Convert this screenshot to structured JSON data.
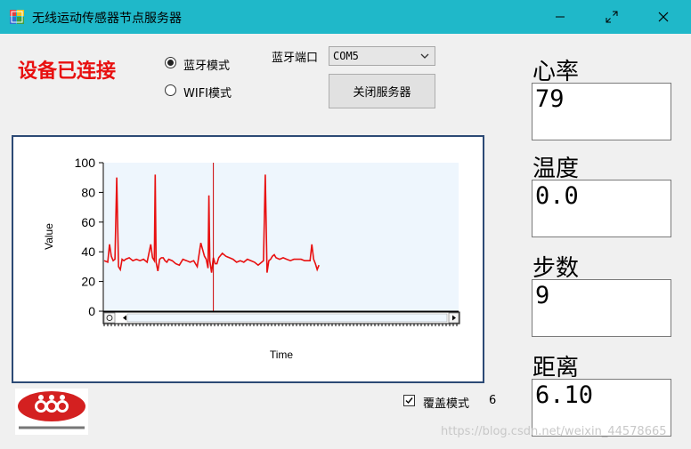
{
  "window": {
    "title": "无线运动传感器节点服务器",
    "buttons": [
      "minimize-icon",
      "maximize-icon",
      "close-icon"
    ]
  },
  "status": {
    "text": "设备已连接",
    "color": "#e81010"
  },
  "modes": [
    {
      "label": "蓝牙模式",
      "selected": true
    },
    {
      "label": "WIFI模式",
      "selected": false
    }
  ],
  "port": {
    "label": "蓝牙端口",
    "selected": "COM5"
  },
  "server_button": {
    "label": "关闭服务器"
  },
  "readings": [
    {
      "label": "心率",
      "value": "79"
    },
    {
      "label": "温度",
      "value": "0.0"
    },
    {
      "label": "步数",
      "value": "9"
    },
    {
      "label": "距离",
      "value": "6.10"
    }
  ],
  "overlay": {
    "label": "覆盖模式",
    "checked": true,
    "count": "6"
  },
  "watermark": "https://blog.csdn.net/weixin_44578665",
  "chart_data": {
    "type": "line",
    "xlabel": "Time",
    "ylabel": "Value",
    "ylim": [
      0,
      100
    ],
    "yticks": [
      0,
      20,
      40,
      60,
      80,
      100
    ],
    "color": "#e81010",
    "cursor_x": 61,
    "x": [
      0,
      2,
      3,
      4,
      5,
      6,
      7,
      8,
      9,
      10,
      11,
      12,
      14,
      16,
      18,
      20,
      22,
      24,
      26,
      27,
      28,
      28.5,
      29,
      30,
      31,
      32,
      33,
      34,
      35,
      36,
      38,
      40,
      42,
      44,
      46,
      48,
      50,
      52,
      54,
      56,
      57,
      58,
      58.5,
      59,
      60,
      61,
      62,
      63,
      64,
      66,
      68,
      70,
      72,
      74,
      76,
      78,
      80,
      82,
      84,
      86,
      88,
      89,
      90,
      91,
      92,
      93,
      94,
      95,
      96,
      98,
      100,
      102,
      104,
      106,
      108,
      110,
      112,
      114,
      115,
      116,
      117,
      118,
      119,
      120
    ],
    "y": [
      34,
      33,
      45,
      37,
      34,
      35,
      90,
      30,
      28,
      35,
      34,
      35,
      36,
      34,
      35,
      34,
      35,
      33,
      45,
      36,
      34,
      92,
      33,
      27,
      35,
      36,
      36,
      34,
      33,
      35,
      34,
      32,
      31,
      35,
      34,
      33,
      34,
      30,
      46,
      37,
      35,
      29,
      78,
      34,
      26,
      36,
      32,
      32,
      36,
      39,
      37,
      36,
      35,
      33,
      34,
      33,
      35,
      34,
      33,
      31,
      33,
      34,
      92,
      26,
      34,
      35,
      37,
      38,
      36,
      35,
      36,
      35,
      34,
      35,
      35,
      35,
      34,
      34,
      34,
      45,
      35,
      32,
      28,
      31,
      30,
      31
    ]
  }
}
